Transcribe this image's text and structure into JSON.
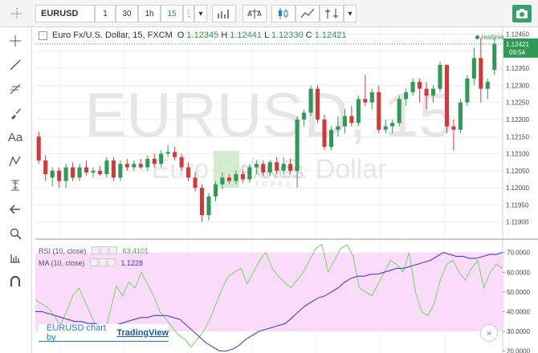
{
  "toolbar": {
    "symbol": "EURUSD",
    "intervals": [
      "1",
      "30",
      "1h",
      "15"
    ],
    "active_interval": "15",
    "snapshot_icon": "camera-icon"
  },
  "sidebar_icons": [
    "crosshair-icon",
    "trendline-icon",
    "fib-icon",
    "brush-icon",
    "text-icon",
    "pattern-icon",
    "measure-icon",
    "arrow-left-icon",
    "zoom-icon",
    "ruler-icon",
    "magnet-icon"
  ],
  "legend": {
    "title": "Euro Fx/U.S. Dollar, 15, FXCM",
    "o_label": "O",
    "o": "1.12345",
    "h_label": "H",
    "h": "1.12441",
    "l_label": "L",
    "l": "1.12330",
    "c_label": "C",
    "c": "1.12421"
  },
  "realtime": "realtime",
  "watermark": {
    "symbol": "EURUSD, 15",
    "name": "Euro Fx/U.S. Dollar",
    "logo_text": "RANGS",
    "logo_sub": "FOREX"
  },
  "price_tag": {
    "price": "1.12421",
    "countdown": "09:54"
  },
  "rsi_legend": {
    "label": "RSI (10, close)",
    "value": "63.4101"
  },
  "ma_legend": {
    "label": "MA (10, close)",
    "value": "1.1228"
  },
  "credit": {
    "prefix": "EURUSD chart by",
    "link": "TradingView"
  },
  "scroll_button": "»",
  "colors": {
    "up": "#2e9a55",
    "down": "#d23a3a",
    "rsi": "#7bd86a",
    "ma": "#4a3ed6",
    "rsi_band": "#fadcfa"
  },
  "chart_data": [
    {
      "type": "candlestick",
      "title": "Euro Fx/U.S. Dollar, 15, FXCM",
      "ylim": [
        1.1185,
        1.1247
      ],
      "y_ticks": [
        "1.12450",
        "1.12400",
        "1.12350",
        "1.12300",
        "1.12250",
        "1.12200",
        "1.12150",
        "1.12100",
        "1.12050",
        "1.12000",
        "1.11950",
        "1.11900"
      ],
      "candles": [
        {
          "o": 1.1215,
          "h": 1.12165,
          "l": 1.1207,
          "c": 1.1208
        },
        {
          "o": 1.1208,
          "h": 1.12095,
          "l": 1.1202,
          "c": 1.1204
        },
        {
          "o": 1.1203,
          "h": 1.1206,
          "l": 1.12005,
          "c": 1.1205
        },
        {
          "o": 1.1205,
          "h": 1.1206,
          "l": 1.12,
          "c": 1.1202
        },
        {
          "o": 1.1202,
          "h": 1.1207,
          "l": 1.12,
          "c": 1.1206
        },
        {
          "o": 1.1206,
          "h": 1.12075,
          "l": 1.1202,
          "c": 1.1203
        },
        {
          "o": 1.1203,
          "h": 1.1207,
          "l": 1.1202,
          "c": 1.1206
        },
        {
          "o": 1.1206,
          "h": 1.1208,
          "l": 1.12035,
          "c": 1.12045
        },
        {
          "o": 1.12045,
          "h": 1.1206,
          "l": 1.1203,
          "c": 1.1205
        },
        {
          "o": 1.1205,
          "h": 1.12065,
          "l": 1.12035,
          "c": 1.1204
        },
        {
          "o": 1.1204,
          "h": 1.1209,
          "l": 1.1203,
          "c": 1.1208
        },
        {
          "o": 1.1208,
          "h": 1.1209,
          "l": 1.1202,
          "c": 1.1203
        },
        {
          "o": 1.1203,
          "h": 1.1208,
          "l": 1.1202,
          "c": 1.1207
        },
        {
          "o": 1.1207,
          "h": 1.12085,
          "l": 1.1205,
          "c": 1.1206
        },
        {
          "o": 1.1206,
          "h": 1.1208,
          "l": 1.1205,
          "c": 1.1207
        },
        {
          "o": 1.1207,
          "h": 1.12085,
          "l": 1.12055,
          "c": 1.1206
        },
        {
          "o": 1.1206,
          "h": 1.12095,
          "l": 1.1205,
          "c": 1.12085
        },
        {
          "o": 1.12085,
          "h": 1.121,
          "l": 1.1206,
          "c": 1.1207
        },
        {
          "o": 1.1207,
          "h": 1.1211,
          "l": 1.1206,
          "c": 1.121
        },
        {
          "o": 1.121,
          "h": 1.12125,
          "l": 1.1209,
          "c": 1.12105
        },
        {
          "o": 1.12105,
          "h": 1.1212,
          "l": 1.1208,
          "c": 1.1209
        },
        {
          "o": 1.1209,
          "h": 1.121,
          "l": 1.1205,
          "c": 1.1206
        },
        {
          "o": 1.1206,
          "h": 1.12075,
          "l": 1.1202,
          "c": 1.1203
        },
        {
          "o": 1.1203,
          "h": 1.12045,
          "l": 1.1199,
          "c": 1.12
        },
        {
          "o": 1.12,
          "h": 1.1201,
          "l": 1.119,
          "c": 1.1192
        },
        {
          "o": 1.1192,
          "h": 1.11985,
          "l": 1.11905,
          "c": 1.11975
        },
        {
          "o": 1.11975,
          "h": 1.1202,
          "l": 1.1196,
          "c": 1.1201
        },
        {
          "o": 1.1201,
          "h": 1.12045,
          "l": 1.11995,
          "c": 1.1203
        },
        {
          "o": 1.1203,
          "h": 1.1204,
          "l": 1.1201,
          "c": 1.1202
        },
        {
          "o": 1.1202,
          "h": 1.1205,
          "l": 1.1201,
          "c": 1.1204
        },
        {
          "o": 1.1204,
          "h": 1.1205,
          "l": 1.12015,
          "c": 1.12025
        },
        {
          "o": 1.12025,
          "h": 1.1207,
          "l": 1.12015,
          "c": 1.1206
        },
        {
          "o": 1.1206,
          "h": 1.1208,
          "l": 1.1204,
          "c": 1.1207
        },
        {
          "o": 1.1207,
          "h": 1.1208,
          "l": 1.12035,
          "c": 1.12045
        },
        {
          "o": 1.12045,
          "h": 1.1208,
          "l": 1.12035,
          "c": 1.12075
        },
        {
          "o": 1.12075,
          "h": 1.1209,
          "l": 1.1204,
          "c": 1.1205
        },
        {
          "o": 1.1205,
          "h": 1.1209,
          "l": 1.1204,
          "c": 1.1207
        },
        {
          "o": 1.1207,
          "h": 1.12085,
          "l": 1.1204,
          "c": 1.1205
        },
        {
          "o": 1.1205,
          "h": 1.1221,
          "l": 1.12,
          "c": 1.122
        },
        {
          "o": 1.122,
          "h": 1.1223,
          "l": 1.1218,
          "c": 1.1222
        },
        {
          "o": 1.1222,
          "h": 1.123,
          "l": 1.1221,
          "c": 1.1229
        },
        {
          "o": 1.1229,
          "h": 1.123,
          "l": 1.1219,
          "c": 1.122
        },
        {
          "o": 1.122,
          "h": 1.12215,
          "l": 1.1211,
          "c": 1.1212
        },
        {
          "o": 1.1212,
          "h": 1.1218,
          "l": 1.1211,
          "c": 1.1217
        },
        {
          "o": 1.1217,
          "h": 1.1221,
          "l": 1.1215,
          "c": 1.1218
        },
        {
          "o": 1.1218,
          "h": 1.1223,
          "l": 1.1216,
          "c": 1.1221
        },
        {
          "o": 1.1221,
          "h": 1.1224,
          "l": 1.1218,
          "c": 1.1219
        },
        {
          "o": 1.1219,
          "h": 1.1227,
          "l": 1.1218,
          "c": 1.1226
        },
        {
          "o": 1.1226,
          "h": 1.1233,
          "l": 1.1224,
          "c": 1.1225
        },
        {
          "o": 1.1225,
          "h": 1.1229,
          "l": 1.1223,
          "c": 1.1228
        },
        {
          "o": 1.1228,
          "h": 1.123,
          "l": 1.1216,
          "c": 1.1217
        },
        {
          "o": 1.1217,
          "h": 1.122,
          "l": 1.1216,
          "c": 1.1218
        },
        {
          "o": 1.1218,
          "h": 1.122,
          "l": 1.1216,
          "c": 1.1219
        },
        {
          "o": 1.1219,
          "h": 1.1227,
          "l": 1.1218,
          "c": 1.1226
        },
        {
          "o": 1.1226,
          "h": 1.1229,
          "l": 1.1224,
          "c": 1.1228
        },
        {
          "o": 1.1228,
          "h": 1.1232,
          "l": 1.1227,
          "c": 1.1231
        },
        {
          "o": 1.1231,
          "h": 1.1232,
          "l": 1.1225,
          "c": 1.1229
        },
        {
          "o": 1.1229,
          "h": 1.1231,
          "l": 1.1223,
          "c": 1.1227
        },
        {
          "o": 1.1227,
          "h": 1.123,
          "l": 1.1225,
          "c": 1.1229
        },
        {
          "o": 1.1229,
          "h": 1.1237,
          "l": 1.1228,
          "c": 1.1236
        },
        {
          "o": 1.1236,
          "h": 1.1236,
          "l": 1.1216,
          "c": 1.1218
        },
        {
          "o": 1.1218,
          "h": 1.122,
          "l": 1.1211,
          "c": 1.1217
        },
        {
          "o": 1.1217,
          "h": 1.1226,
          "l": 1.1216,
          "c": 1.1225
        },
        {
          "o": 1.1225,
          "h": 1.1233,
          "l": 1.1224,
          "c": 1.1232
        },
        {
          "o": 1.1232,
          "h": 1.1241,
          "l": 1.123,
          "c": 1.1238
        },
        {
          "o": 1.1238,
          "h": 1.1244,
          "l": 1.1225,
          "c": 1.1229
        },
        {
          "o": 1.1229,
          "h": 1.1232,
          "l": 1.1226,
          "c": 1.1231
        },
        {
          "o": 1.12345,
          "h": 1.12441,
          "l": 1.1233,
          "c": 1.12421
        }
      ]
    },
    {
      "type": "line",
      "series": [
        {
          "name": "RSI (10, close)",
          "color": "#7bd86a",
          "values": [
            46,
            44,
            42,
            38,
            33,
            40,
            48,
            52,
            45,
            38,
            30,
            28,
            40,
            53,
            48,
            55,
            52,
            60,
            54,
            48,
            40,
            36,
            32,
            28,
            26,
            22,
            26,
            30,
            36,
            44,
            52,
            58,
            60,
            62,
            54,
            60,
            66,
            70,
            62,
            58,
            55,
            52,
            56,
            60,
            66,
            72,
            74,
            60,
            66,
            72,
            74,
            68,
            52,
            50,
            48,
            54,
            60,
            66,
            64,
            60,
            70,
            50,
            40,
            38,
            44,
            56,
            64,
            66,
            60,
            56,
            62,
            66,
            52,
            60,
            64,
            62
          ]
        },
        {
          "name": "MA (10, close)",
          "color": "#4a3ed6",
          "values": [
            40,
            40,
            39,
            38,
            37,
            36,
            35,
            35,
            34,
            34,
            33,
            33,
            33,
            34,
            35,
            36,
            37,
            37,
            38,
            38,
            38,
            37,
            36,
            33,
            30,
            27,
            24,
            22,
            20,
            20,
            21,
            23,
            26,
            28,
            30,
            31,
            32,
            33,
            34,
            37,
            40,
            43,
            45,
            47,
            48,
            50,
            52,
            55,
            57,
            58,
            58,
            59,
            59,
            60,
            61,
            62,
            62,
            63,
            64,
            65,
            66,
            68,
            70,
            69,
            68,
            68,
            67,
            67,
            68,
            69,
            69,
            70
          ]
        }
      ],
      "ylim": [
        19,
        76
      ],
      "y_ticks": [
        "70.0000",
        "60.0000",
        "50.0000",
        "40.0000",
        "30.0000",
        "20.0000"
      ],
      "band": [
        30,
        70
      ]
    }
  ]
}
